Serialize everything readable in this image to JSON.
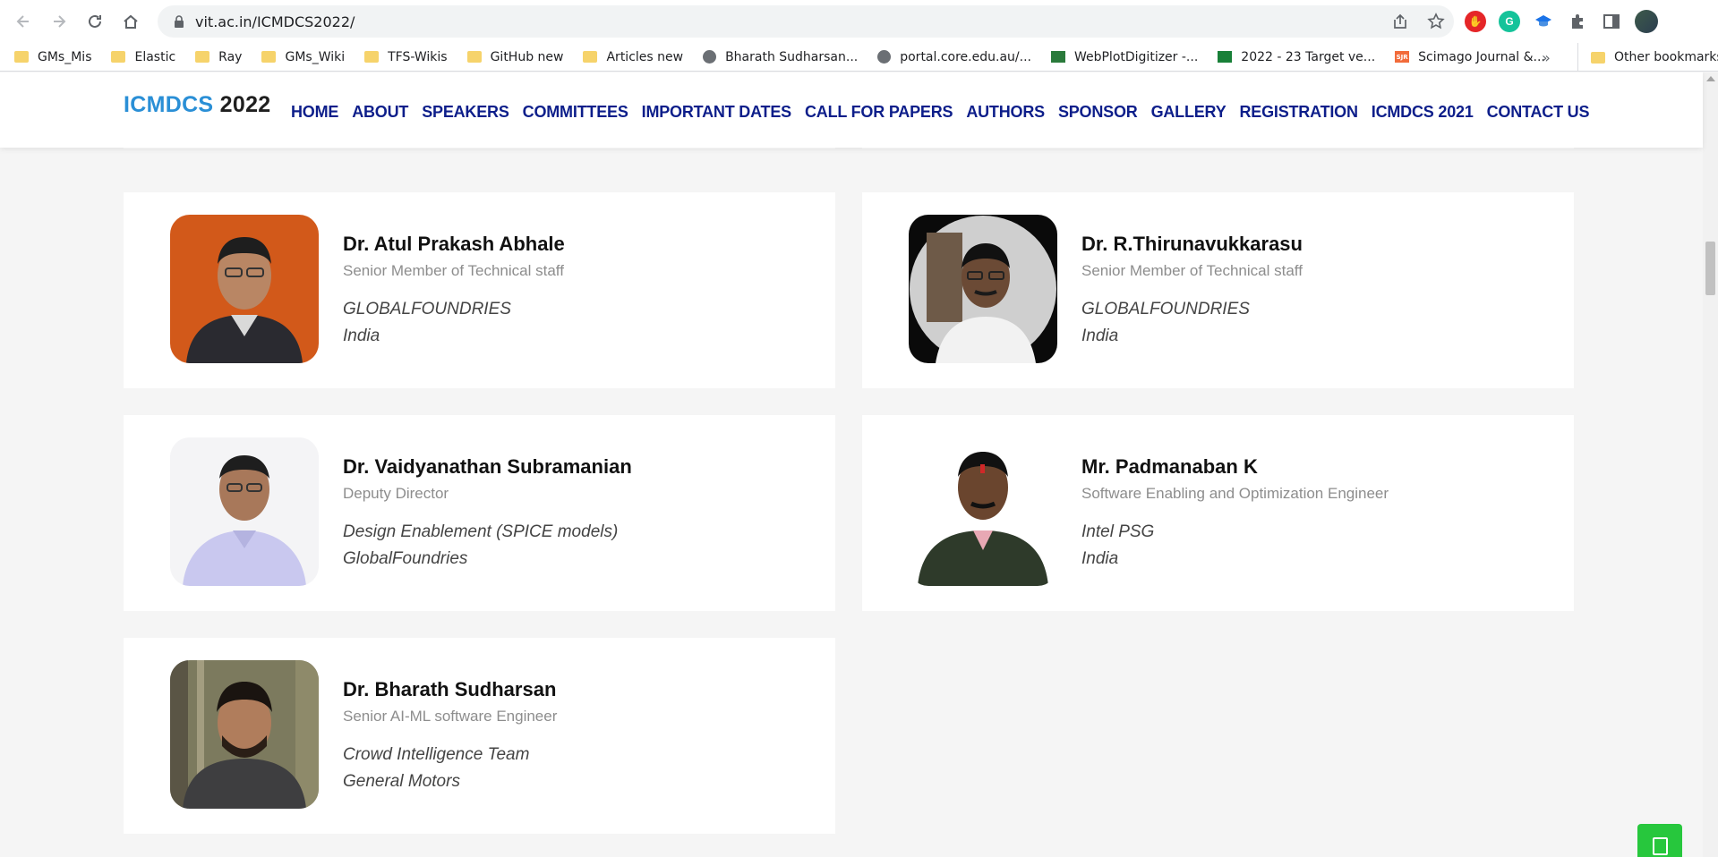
{
  "browser": {
    "url": "vit.ac.in/ICMDCS2022/",
    "bookmarks": [
      {
        "label": "GMs_Mis",
        "icon": "folder-icon"
      },
      {
        "label": "Elastic",
        "icon": "folder-icon"
      },
      {
        "label": "Ray",
        "icon": "folder-icon"
      },
      {
        "label": "GMs_Wiki",
        "icon": "folder-icon"
      },
      {
        "label": "TFS-Wikis",
        "icon": "folder-icon"
      },
      {
        "label": "GitHub new",
        "icon": "folder-icon"
      },
      {
        "label": "Articles new",
        "icon": "folder-icon"
      },
      {
        "label": "Bharath Sudharsan...",
        "icon": "globe-icon"
      },
      {
        "label": "portal.core.edu.au/...",
        "icon": "globe-icon"
      },
      {
        "label": "WebPlotDigitizer -...",
        "icon": "webplotdigitizer-icon"
      },
      {
        "label": "2022 - 23 Target ve...",
        "icon": "sheets-icon"
      },
      {
        "label": "Scimago Journal &...",
        "icon": "sjr-icon"
      }
    ],
    "more_bookmarks": "»",
    "other_bookmarks": "Other bookmarks",
    "sjr_badge": "SJR"
  },
  "site": {
    "logo_part1": "ICMDCS",
    "logo_part2": "2022",
    "nav": [
      "HOME",
      "ABOUT",
      "SPEAKERS",
      "COMMITTEES",
      "IMPORTANT DATES",
      "CALL FOR PAPERS",
      "AUTHORS",
      "SPONSOR",
      "GALLERY",
      "REGISTRATION",
      "ICMDCS 2021",
      "CONTACT US"
    ]
  },
  "speakers": [
    {
      "name": "Dr. Atul Prakash Abhale",
      "role": "Senior Member of Technical staff",
      "org": "GLOBALFOUNDRIES",
      "country": "India"
    },
    {
      "name": "Dr. R.Thirunavukkarasu",
      "role": "Senior Member of Technical staff",
      "org": "GLOBALFOUNDRIES",
      "country": "India"
    },
    {
      "name": "Dr. Vaidyanathan Subramanian",
      "role": "Deputy Director",
      "org": "Design Enablement (SPICE models)",
      "country": "GlobalFoundries"
    },
    {
      "name": "Mr. Padmanaban K",
      "role": "Software Enabling and Optimization Engineer",
      "org": "Intel PSG",
      "country": "India"
    },
    {
      "name": "Dr. Bharath Sudharsan",
      "role": "Senior AI-ML software Engineer",
      "org": "Crowd Intelligence Team",
      "country": "General Motors"
    }
  ],
  "colors": {
    "logo_accent": "#2a8fd6",
    "nav_text": "#0d1e8a",
    "page_bg": "#f5f5f5",
    "float_button": "#27c73d"
  }
}
